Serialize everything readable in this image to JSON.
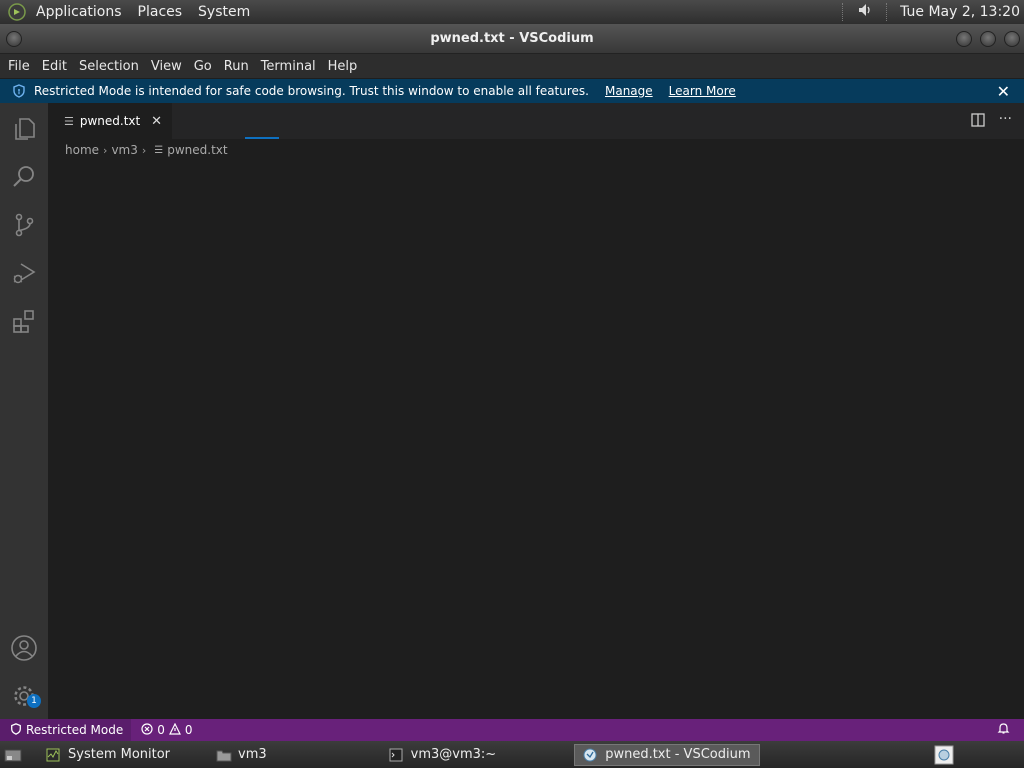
{
  "top_panel": {
    "menus": [
      "Applications",
      "Places",
      "System"
    ],
    "clock": "Tue May  2, 13:20"
  },
  "window": {
    "title": "pwned.txt - VSCodium"
  },
  "menubar": [
    "File",
    "Edit",
    "Selection",
    "View",
    "Go",
    "Run",
    "Terminal",
    "Help"
  ],
  "banner": {
    "message": "Restricted Mode is intended for safe code browsing. Trust this window to enable all features.",
    "manage": "Manage",
    "learn_more": "Learn More"
  },
  "activity_bar": {
    "items": [
      "explorer",
      "search",
      "source-control",
      "run-and-debug",
      "extensions"
    ],
    "settings_badge": "1"
  },
  "editor": {
    "tab": {
      "label": "pwned.txt"
    },
    "breadcrumb": [
      "home",
      "vm3",
      "pwned.txt"
    ]
  },
  "status_bar": {
    "restricted": "Restricted Mode",
    "errors": "0",
    "warnings": "0"
  },
  "taskbar": {
    "items": [
      "System Monitor",
      "vm3",
      "vm3@vm3:~",
      "pwned.txt - VSCodium"
    ],
    "active": "pwned.txt - VSCodium"
  },
  "colors": {
    "banner_bg": "#063b5c",
    "status_bg": "#68217a",
    "accent": "#0e70c0",
    "editor_bg": "#1e1e1e",
    "activity_bg": "#333333"
  }
}
